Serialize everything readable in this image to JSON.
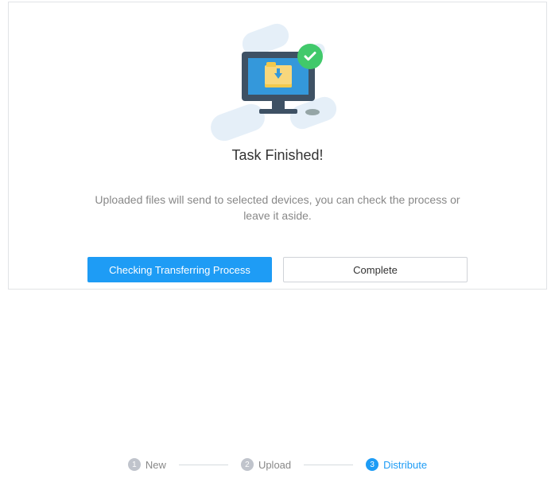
{
  "illustration": {
    "badge": "success-check-icon"
  },
  "dialog": {
    "title": "Task Finished!",
    "subtitle": "Uploaded files will send to selected devices, you can check the process or leave it aside.",
    "primary_button": "Checking Transferring Process",
    "secondary_button": "Complete"
  },
  "stepper": {
    "steps": [
      {
        "num": "1",
        "label": "New",
        "active": false
      },
      {
        "num": "2",
        "label": "Upload",
        "active": false
      },
      {
        "num": "3",
        "label": "Distribute",
        "active": true
      }
    ]
  },
  "colors": {
    "accent": "#1e9cf5",
    "success": "#41c96b",
    "muted": "#c0c4cc"
  }
}
